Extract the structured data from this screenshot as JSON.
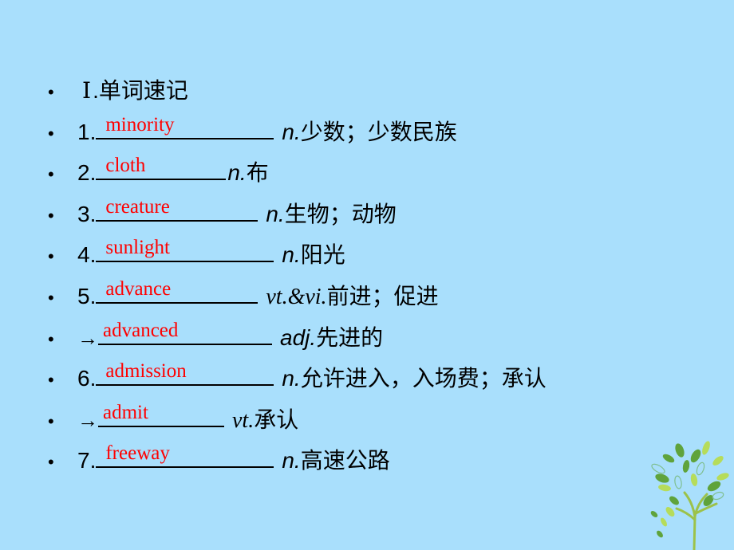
{
  "heading": {
    "bullet": "•",
    "roman": "Ⅰ",
    "title": ".单词速记"
  },
  "items": [
    {
      "prefix": "1.",
      "answer": "minority",
      "pos": "n.",
      "meaning": "少数；少数民族",
      "blank": "long"
    },
    {
      "prefix": "2.",
      "answer": "cloth",
      "pos": "n.",
      "meaning": "布",
      "blank": "short"
    },
    {
      "prefix": "3.",
      "answer": "creature",
      "pos": "n.",
      "meaning": "生物；动物",
      "blank": "mid"
    },
    {
      "prefix": "4.",
      "answer": "sunlight",
      "pos": "n.",
      "meaning": "阳光",
      "blank": "long"
    },
    {
      "prefix": "5.",
      "answer": "advance",
      "pos": "vt.&vi.",
      "meaning": "前进；促进",
      "blank": "mid"
    },
    {
      "prefix": "→",
      "answer": "advanced",
      "pos": "adj.",
      "meaning": "先进的",
      "blank": "long"
    },
    {
      "prefix": "6.",
      "answer": "admission",
      "pos": "n.",
      "meaning": "允许进入，入场费；承认",
      "blank": "long"
    },
    {
      "prefix": "→",
      "answer": "admit",
      "pos": "vt.",
      "meaning": "承认",
      "blank": "short"
    },
    {
      "prefix": "7.",
      "answer": "freeway",
      "pos": "n.",
      "meaning": "高速公路",
      "blank": "long"
    }
  ],
  "bullet": "•",
  "colors": {
    "background": "#a9dffc",
    "answer": "#ff0000",
    "text": "#000000"
  },
  "decoration": {
    "icon": "tree-icon"
  }
}
